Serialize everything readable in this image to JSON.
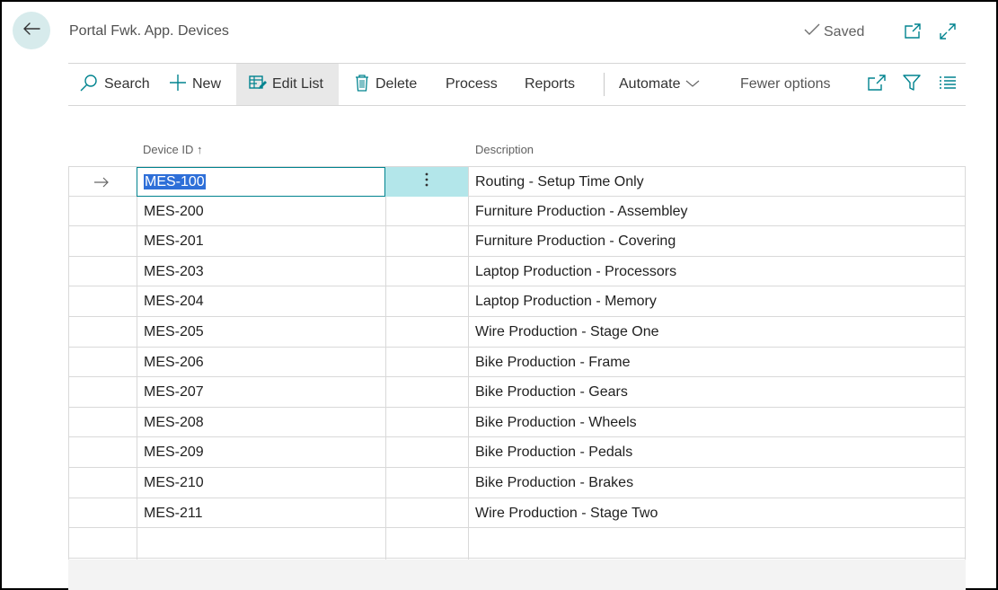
{
  "header": {
    "title": "Portal Fwk. App. Devices",
    "saved_label": "Saved"
  },
  "actions": {
    "search": "Search",
    "new": "New",
    "edit_list": "Edit List",
    "delete": "Delete",
    "process": "Process",
    "reports": "Reports",
    "automate": "Automate",
    "fewer_options": "Fewer options"
  },
  "columns": {
    "device_id": "Device ID",
    "device_id_sort": "↑",
    "description": "Description"
  },
  "rows": [
    {
      "id": "MES-100",
      "desc": "Routing - Setup Time Only"
    },
    {
      "id": "MES-200",
      "desc": "Furniture Production - Assembley"
    },
    {
      "id": "MES-201",
      "desc": "Furniture Production - Covering"
    },
    {
      "id": "MES-203",
      "desc": "Laptop Production - Processors"
    },
    {
      "id": "MES-204",
      "desc": "Laptop Production - Memory"
    },
    {
      "id": "MES-205",
      "desc": "Wire Production - Stage One"
    },
    {
      "id": "MES-206",
      "desc": "Bike Production - Frame"
    },
    {
      "id": "MES-207",
      "desc": "Bike Production - Gears"
    },
    {
      "id": "MES-208",
      "desc": "Bike Production - Wheels"
    },
    {
      "id": "MES-209",
      "desc": "Bike Production - Pedals"
    },
    {
      "id": "MES-210",
      "desc": "Bike Production - Brakes"
    },
    {
      "id": "MES-211",
      "desc": "Wire Production - Stage Two"
    }
  ],
  "icons": {
    "back": "back-arrow-icon",
    "saved": "checkmark-icon",
    "open_new": "open-in-new-window-icon",
    "expand": "expand-icon",
    "search": "search-icon",
    "new": "plus-icon",
    "edit_list": "edit-list-icon",
    "delete": "trash-icon",
    "automate": "chevron-down-icon",
    "share": "share-icon",
    "filter": "filter-icon",
    "list": "list-view-icon",
    "row_arrow": "current-row-arrow-icon",
    "row_menu": "more-options-icon"
  },
  "colors": {
    "accent": "#00838f",
    "selection": "#2e6fd8",
    "back_button_bg": "#d7ebec",
    "active_cell_bg": "#b3e6ea"
  }
}
